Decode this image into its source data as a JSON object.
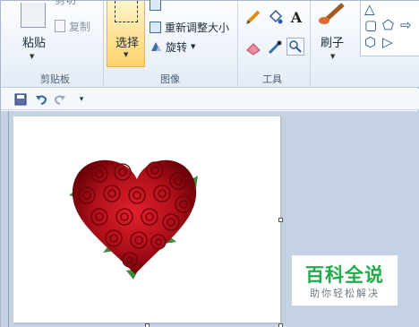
{
  "clipboard": {
    "paste_label": "粘贴",
    "cut_label": "剪切",
    "copy_label": "复制",
    "group_label": "剪贴板"
  },
  "image": {
    "select_label": "选择",
    "resize_label": "重新调整大小",
    "rotate_label": "旋转",
    "group_label": "图像"
  },
  "tools": {
    "text_glyph": "A",
    "group_label": "工具"
  },
  "brushes": {
    "label": "刷子"
  },
  "shapes": [
    "△",
    "▢",
    "⬠",
    "⇨",
    "⬡",
    "▷"
  ],
  "watermark": {
    "title": "百科全说",
    "subtitle": "助你轻松解决"
  },
  "colors": {
    "select_active": "#fdd46a",
    "watermark_green": "#1fad4c",
    "workspace": "#c5d2e3",
    "heart_roses": "#c0121b"
  }
}
